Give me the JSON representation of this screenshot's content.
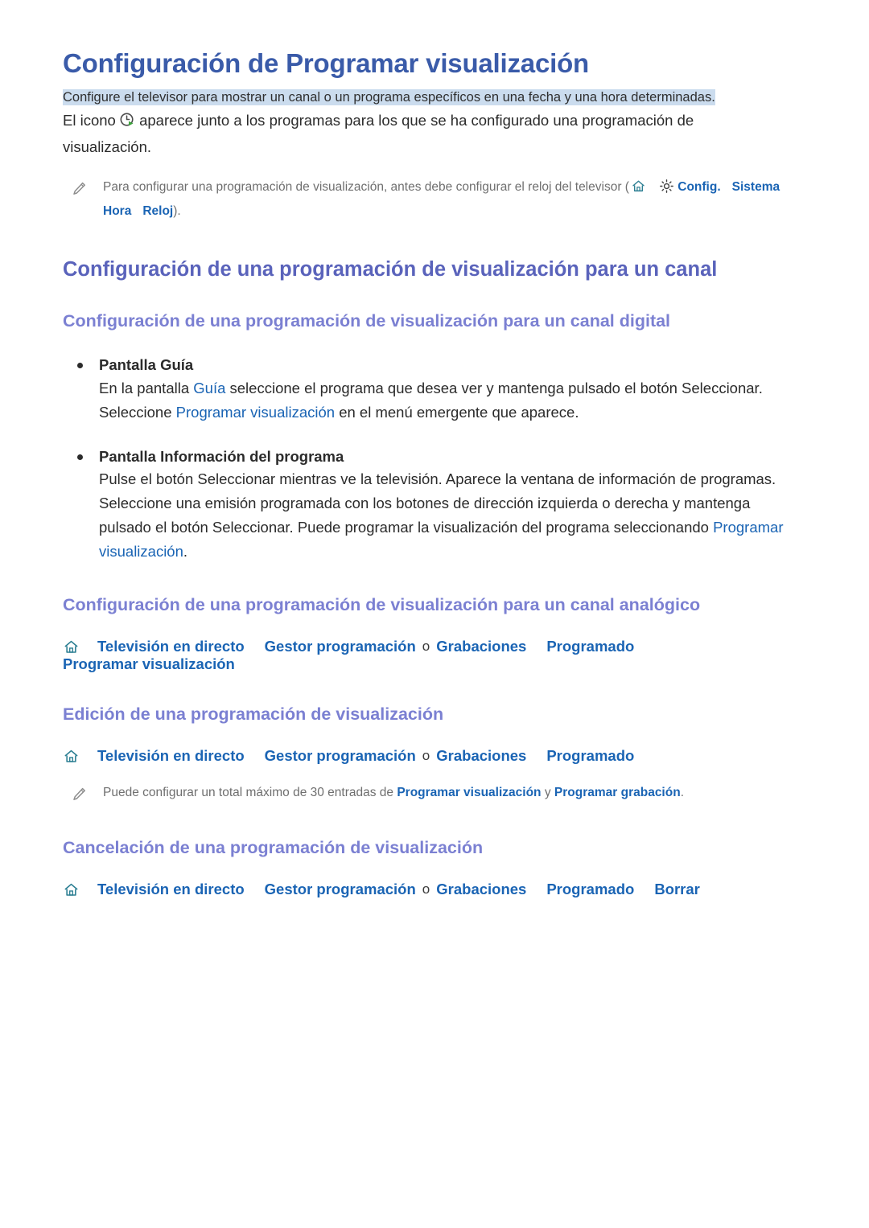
{
  "page": {
    "title": "Configuración de Programar visualización",
    "subtitle": "Configure el televisor para mostrar un canal o un programa específicos en una fecha y una hora determinadas.",
    "accent_title": "#3a5ba9",
    "accent_h2": "#5a63bb",
    "accent_h3": "#7b80d2",
    "accent_link": "#1a64b4",
    "highlight_bg": "#cbdcee",
    "note_text_color": "#6f6f6f"
  },
  "intro": {
    "before_icon": "El icono ",
    "icon": "schedule-clock-icon",
    "after_icon": " aparece junto a los programas para los que se ha configurado una programación de visualización."
  },
  "note_clock": {
    "icon": "pencil-icon",
    "text_before": "Para configurar una programación de visualización, antes debe configurar el reloj del televisor (",
    "home_icon": "home-icon",
    "gear_icon": "gear-icon",
    "links": [
      "Config.",
      "Sistema",
      "Hora",
      "Reloj"
    ],
    "text_after": ")."
  },
  "section_channel": {
    "heading": "Configuración de una programación de visualización para un canal",
    "digital": {
      "heading": "Configuración de una programación de visualización para un canal digital",
      "items": [
        {
          "label": "Pantalla Guía",
          "paragraph": {
            "p1": "En la pantalla ",
            "link1": "Guía",
            "p2": " seleccione el programa que desea ver y mantenga pulsado el botón Seleccionar. Seleccione ",
            "link2": "Programar visualización",
            "p3": " en el menú emergente que aparece."
          }
        },
        {
          "label": "Pantalla Información del programa",
          "paragraph": {
            "p1": "Pulse el botón Seleccionar mientras ve la televisión. Aparece la ventana de información de programas. Seleccione una emisión programada con los botones de dirección izquierda o derecha y mantenga pulsado el botón Seleccionar. Puede programar la visualización del programa seleccionando ",
            "link2": "Programar visualización",
            "p3": "."
          }
        }
      ]
    },
    "analog": {
      "heading": "Configuración de una programación de visualización para un canal analógico",
      "breadcrumb": {
        "home_icon": "home-icon",
        "crumbs": [
          "Televisión en directo",
          "Gestor programación",
          "Grabaciones",
          "Programado",
          "Programar visualización"
        ],
        "separator_word": "o"
      }
    }
  },
  "section_edit": {
    "heading": "Edición de una programación de visualización",
    "breadcrumb": {
      "home_icon": "home-icon",
      "crumbs": [
        "Televisión en directo",
        "Gestor programación",
        "Grabaciones",
        "Programado"
      ],
      "separator_word": "o"
    },
    "note": {
      "icon": "pencil-icon",
      "text_before": "Puede configurar un total máximo de 30 entradas de ",
      "link1": "Programar visualización",
      "text_mid": " y ",
      "link2": "Programar grabación",
      "text_after": "."
    }
  },
  "section_cancel": {
    "heading": "Cancelación de una programación de visualización",
    "breadcrumb": {
      "home_icon": "home-icon",
      "crumbs": [
        "Televisión en directo",
        "Gestor programación",
        "Grabaciones",
        "Programado",
        "Borrar"
      ],
      "separator_word": "o"
    }
  }
}
